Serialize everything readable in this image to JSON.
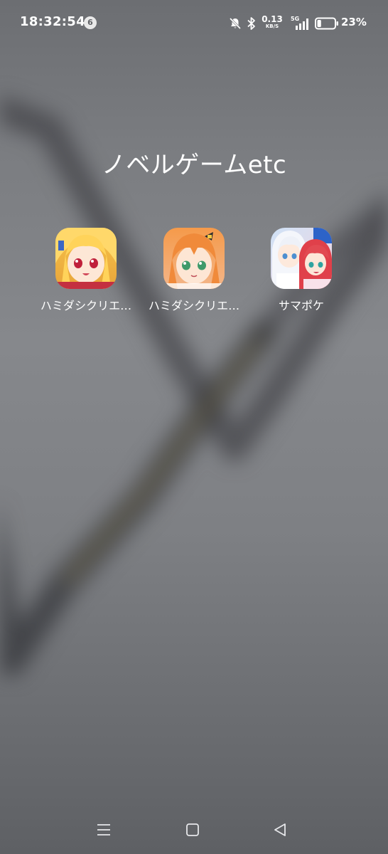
{
  "status_bar": {
    "time": "18:32:54",
    "notification_count": "6",
    "net_speed_value": "0.13",
    "net_speed_unit": "KB/S",
    "network_type": "5G",
    "battery_percent": "23%",
    "battery_level": 0.23,
    "icons": [
      "bell-muted-icon",
      "bluetooth-icon",
      "signal-icon",
      "battery-icon"
    ]
  },
  "folder": {
    "title": "ノベルゲームetc",
    "apps": [
      {
        "label": "ハミダシクリエ…",
        "icon": "app-icon-blonde-girl"
      },
      {
        "label": "ハミダシクリエ…",
        "icon": "app-icon-orange-hair-girl"
      },
      {
        "label": "サマポケ",
        "icon": "app-icon-two-girls"
      }
    ]
  },
  "nav_bar": {
    "buttons": [
      "menu-icon",
      "home-icon",
      "back-icon"
    ]
  },
  "colors": {
    "text": "#ffffff",
    "wallpaper": "#7a7c80"
  }
}
